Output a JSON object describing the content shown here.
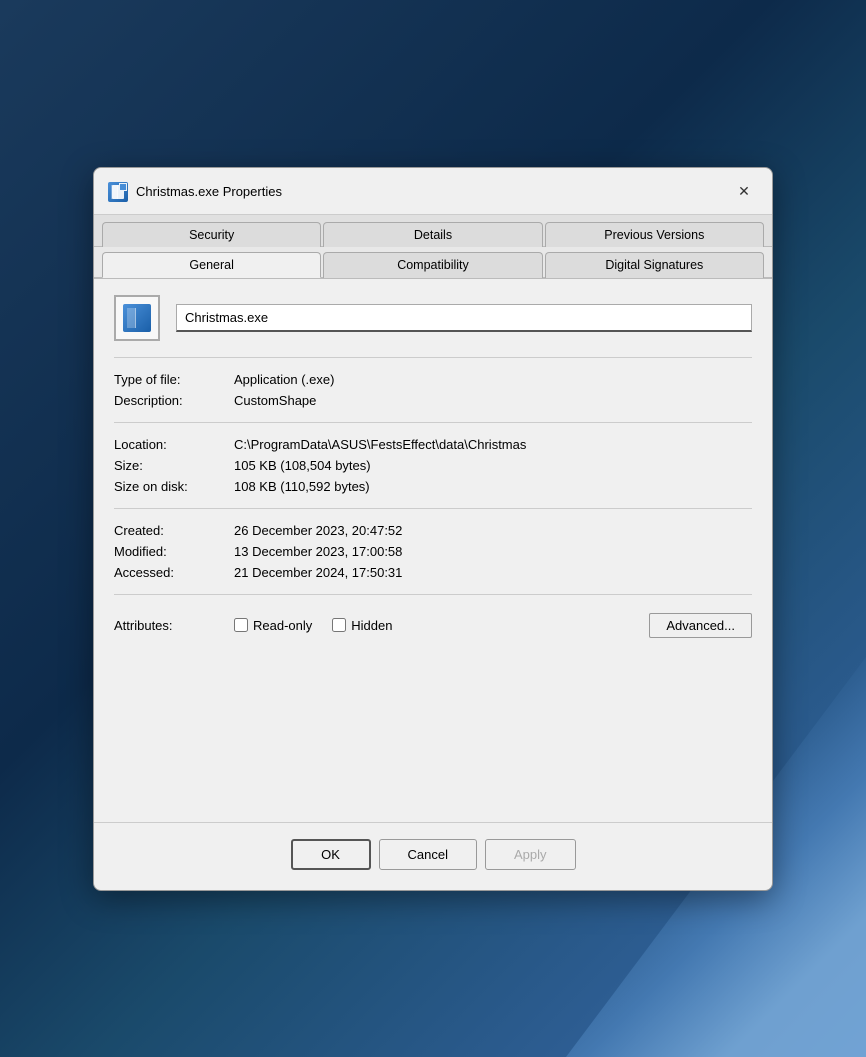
{
  "dialog": {
    "title": "Christmas.exe Properties",
    "close_label": "✕"
  },
  "tabs": {
    "row1": [
      {
        "id": "security",
        "label": "Security",
        "active": false
      },
      {
        "id": "details",
        "label": "Details",
        "active": false
      },
      {
        "id": "previous-versions",
        "label": "Previous Versions",
        "active": false
      }
    ],
    "row2": [
      {
        "id": "general",
        "label": "General",
        "active": true
      },
      {
        "id": "compatibility",
        "label": "Compatibility",
        "active": false
      },
      {
        "id": "digital-signatures",
        "label": "Digital Signatures",
        "active": false
      }
    ]
  },
  "file": {
    "name": "Christmas.exe"
  },
  "properties": {
    "type_label": "Type of file:",
    "type_value": "Application (.exe)",
    "description_label": "Description:",
    "description_value": "CustomShape",
    "location_label": "Location:",
    "location_value": "C:\\ProgramData\\ASUS\\FestsEffect\\data\\Christmas",
    "size_label": "Size:",
    "size_value": "105 KB (108,504 bytes)",
    "size_on_disk_label": "Size on disk:",
    "size_on_disk_value": "108 KB (110,592 bytes)",
    "created_label": "Created:",
    "created_value": "26 December 2023, 20:47:52",
    "modified_label": "Modified:",
    "modified_value": "13 December 2023, 17:00:58",
    "accessed_label": "Accessed:",
    "accessed_value": "21 December 2024, 17:50:31",
    "attributes_label": "Attributes:"
  },
  "attributes": {
    "readonly_label": "Read-only",
    "readonly_checked": false,
    "hidden_label": "Hidden",
    "hidden_checked": false,
    "advanced_label": "Advanced..."
  },
  "buttons": {
    "ok": "OK",
    "cancel": "Cancel",
    "apply": "Apply"
  }
}
